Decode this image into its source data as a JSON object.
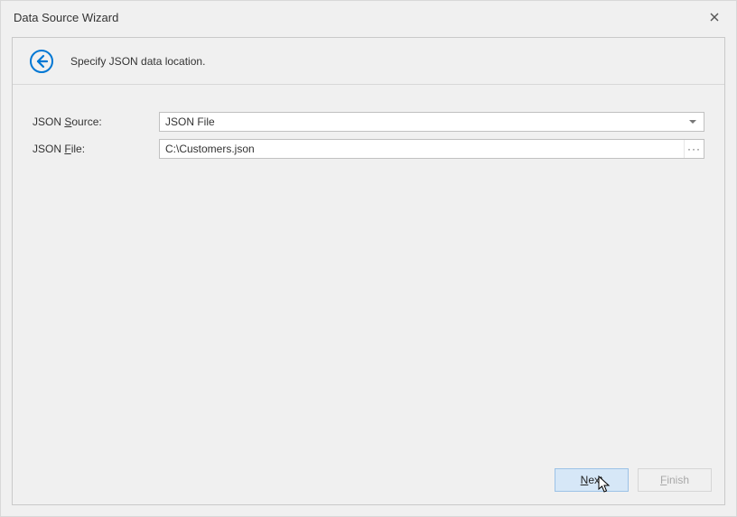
{
  "window": {
    "title": "Data Source Wizard"
  },
  "header": {
    "instruction": "Specify JSON data location."
  },
  "form": {
    "source_label_pre": "JSON ",
    "source_label_ul": "S",
    "source_label_post": "ource:",
    "source_value": "JSON File",
    "file_label_pre": "JSON ",
    "file_label_ul": "F",
    "file_label_post": "ile:",
    "file_value": "C:\\Customers.json",
    "browse_label": "···"
  },
  "buttons": {
    "next_ul": "N",
    "next_rest": "ext",
    "finish_ul": "F",
    "finish_rest": "inish"
  }
}
